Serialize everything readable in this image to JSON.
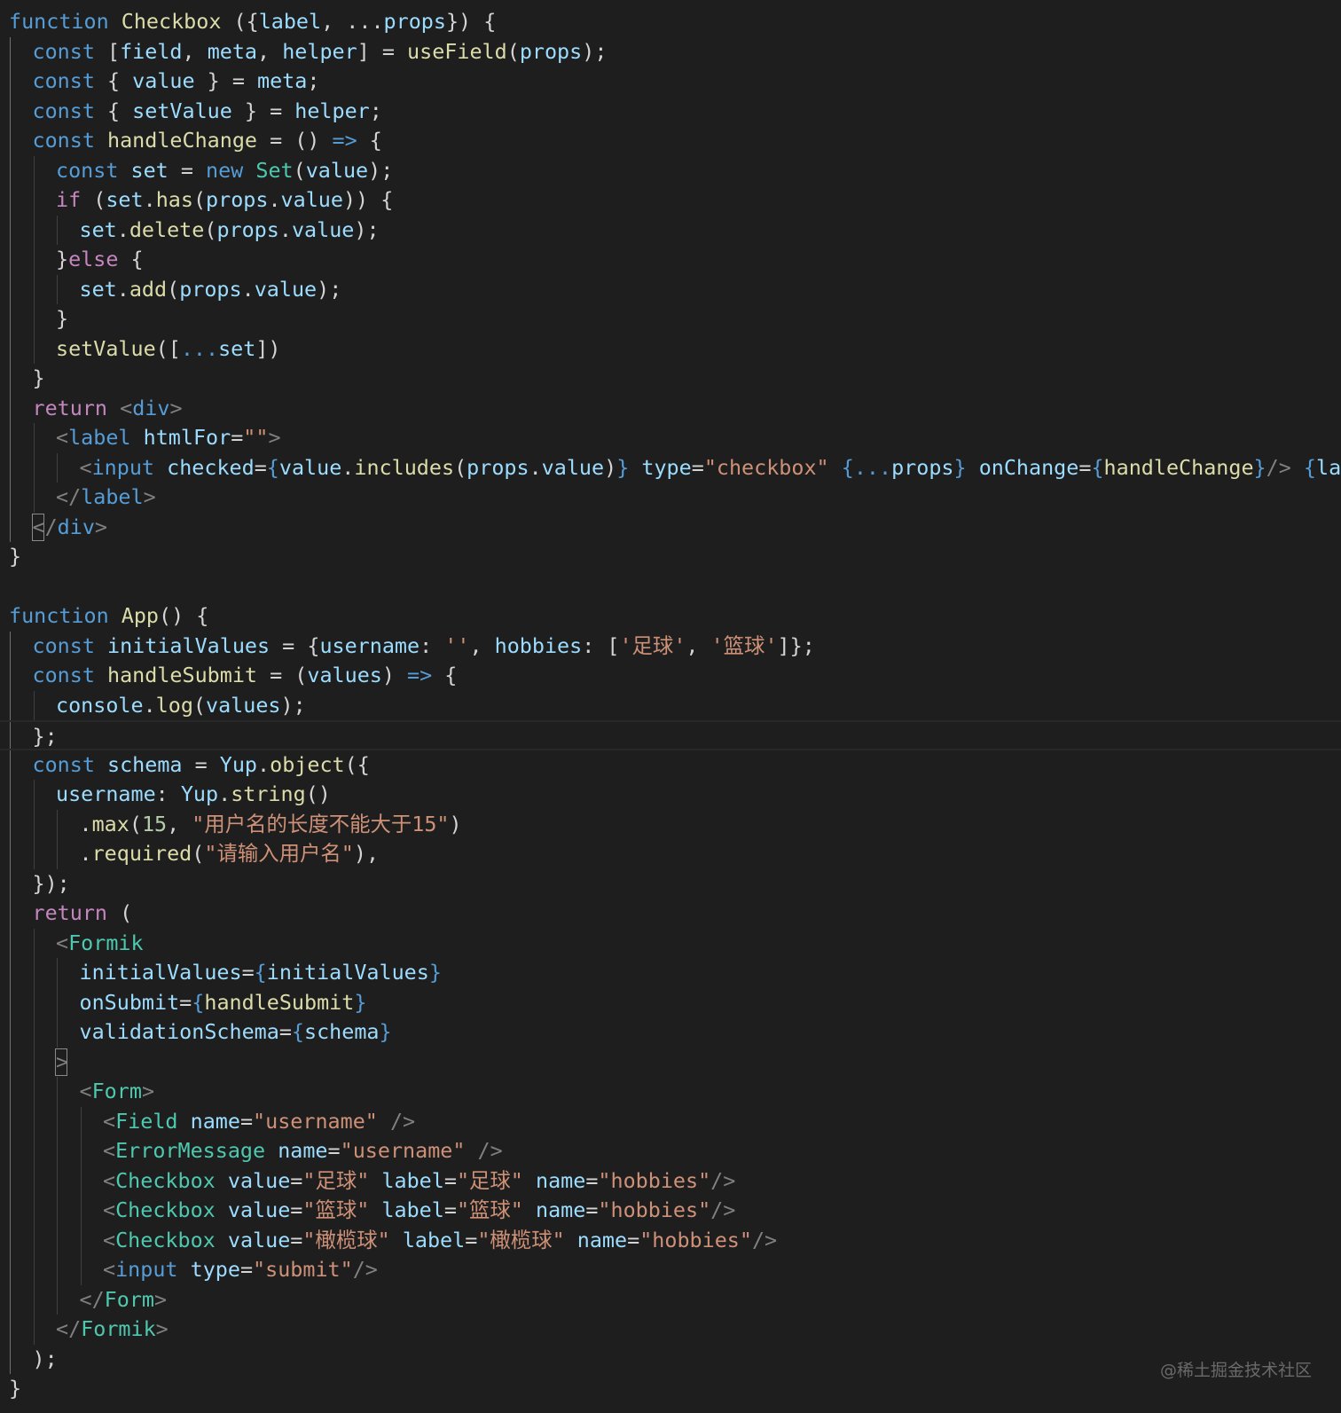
{
  "colors": {
    "background": "#1e1e1e",
    "keyword": "#569cd6",
    "function": "#dcdcaa",
    "variable": "#9cdcfe",
    "type": "#4ec9b0",
    "string": "#ce9178",
    "control": "#c586c0",
    "number": "#b5cea8",
    "tag_punct": "#808080",
    "plain": "#d4d4d4"
  },
  "current_line_index": 24,
  "lines": [
    {
      "i": 0,
      "t": [
        [
          "function",
          "kw"
        ],
        [
          " "
        ],
        [
          "Checkbox",
          "fn"
        ],
        [
          " ({"
        ],
        [
          "label",
          "var"
        ],
        [
          ", ..."
        ],
        [
          "props",
          "var"
        ],
        [
          "}) {"
        ]
      ]
    },
    {
      "i": 1,
      "t": [
        [
          "const",
          "kw"
        ],
        [
          " ["
        ],
        [
          "field",
          "var"
        ],
        [
          ", "
        ],
        [
          "meta",
          "var"
        ],
        [
          ", "
        ],
        [
          "helper",
          "var"
        ],
        [
          "] = "
        ],
        [
          "useField",
          "fn"
        ],
        [
          "("
        ],
        [
          "props",
          "var"
        ],
        [
          ");"
        ]
      ]
    },
    {
      "i": 1,
      "t": [
        [
          "const",
          "kw"
        ],
        [
          " { "
        ],
        [
          "value",
          "var"
        ],
        [
          " } = "
        ],
        [
          "meta",
          "var"
        ],
        [
          ";"
        ]
      ]
    },
    {
      "i": 1,
      "t": [
        [
          "const",
          "kw"
        ],
        [
          " { "
        ],
        [
          "setValue",
          "var"
        ],
        [
          " } = "
        ],
        [
          "helper",
          "var"
        ],
        [
          ";"
        ]
      ]
    },
    {
      "i": 1,
      "t": [
        [
          "const",
          "kw"
        ],
        [
          " "
        ],
        [
          "handleChange",
          "fn"
        ],
        [
          " = () "
        ],
        [
          "=>",
          "kw"
        ],
        [
          " {"
        ]
      ]
    },
    {
      "i": 2,
      "t": [
        [
          "const",
          "kw"
        ],
        [
          " "
        ],
        [
          "set",
          "var"
        ],
        [
          " = "
        ],
        [
          "new",
          "kw"
        ],
        [
          " "
        ],
        [
          "Set",
          "type"
        ],
        [
          "("
        ],
        [
          "value",
          "var"
        ],
        [
          ");"
        ]
      ]
    },
    {
      "i": 2,
      "t": [
        [
          "if",
          "ctl"
        ],
        [
          " ("
        ],
        [
          "set",
          "var"
        ],
        [
          "."
        ],
        [
          "has",
          "fn"
        ],
        [
          "("
        ],
        [
          "props",
          "var"
        ],
        [
          "."
        ],
        [
          "value",
          "var"
        ],
        [
          ")) {"
        ]
      ]
    },
    {
      "i": 3,
      "t": [
        [
          "set",
          "var"
        ],
        [
          "."
        ],
        [
          "delete",
          "fn"
        ],
        [
          "("
        ],
        [
          "props",
          "var"
        ],
        [
          "."
        ],
        [
          "value",
          "var"
        ],
        [
          ");"
        ]
      ]
    },
    {
      "i": 2,
      "t": [
        [
          "}"
        ],
        [
          "else",
          "ctl"
        ],
        [
          " {"
        ]
      ]
    },
    {
      "i": 3,
      "t": [
        [
          "set",
          "var"
        ],
        [
          "."
        ],
        [
          "add",
          "fn"
        ],
        [
          "("
        ],
        [
          "props",
          "var"
        ],
        [
          "."
        ],
        [
          "value",
          "var"
        ],
        [
          ");"
        ]
      ]
    },
    {
      "i": 2,
      "t": [
        [
          "}"
        ]
      ]
    },
    {
      "i": 2,
      "t": [
        [
          "setValue",
          "fn"
        ],
        [
          "(["
        ],
        [
          "...",
          "kw"
        ],
        [
          "set",
          "var"
        ],
        [
          "])"
        ]
      ]
    },
    {
      "i": 1,
      "t": [
        [
          "}"
        ]
      ]
    },
    {
      "i": 1,
      "t": [
        [
          "return",
          "ctl"
        ],
        [
          " "
        ],
        [
          "<",
          "tp"
        ],
        [
          "div",
          "kw"
        ],
        [
          ">",
          "tp"
        ]
      ]
    },
    {
      "i": 2,
      "t": [
        [
          "<",
          "tp"
        ],
        [
          "label",
          "kw"
        ],
        [
          " "
        ],
        [
          "htmlFor",
          "var"
        ],
        [
          "="
        ],
        [
          "\"\"",
          "str"
        ],
        [
          ">",
          "tp"
        ]
      ]
    },
    {
      "i": 3,
      "t": [
        [
          "<",
          "tp"
        ],
        [
          "input",
          "kw"
        ],
        [
          " "
        ],
        [
          "checked",
          "var"
        ],
        [
          "="
        ],
        [
          "{",
          "kw"
        ],
        [
          "value",
          "var"
        ],
        [
          "."
        ],
        [
          "includes",
          "fn"
        ],
        [
          "("
        ],
        [
          "props",
          "var"
        ],
        [
          "."
        ],
        [
          "value",
          "var"
        ],
        [
          ")"
        ],
        [
          "}",
          "kw"
        ],
        [
          " "
        ],
        [
          "type",
          "var"
        ],
        [
          "="
        ],
        [
          "\"checkbox\"",
          "str"
        ],
        [
          " "
        ],
        [
          "{",
          "kw"
        ],
        [
          "...",
          "kw"
        ],
        [
          "props",
          "var"
        ],
        [
          "}",
          "kw"
        ],
        [
          " "
        ],
        [
          "onChange",
          "var"
        ],
        [
          "="
        ],
        [
          "{",
          "kw"
        ],
        [
          "handleChange",
          "fn"
        ],
        [
          "}",
          "kw"
        ],
        [
          "/>",
          "tp"
        ],
        [
          " "
        ],
        [
          "{",
          "kw"
        ],
        [
          "label",
          "var"
        ],
        [
          "}",
          "kw"
        ]
      ]
    },
    {
      "i": 2,
      "t": [
        [
          "</",
          "tp"
        ],
        [
          "label",
          "kw"
        ],
        [
          ">",
          "tp"
        ]
      ]
    },
    {
      "i": 1,
      "t": [
        [
          "</",
          "tp"
        ],
        [
          "div",
          "kw"
        ],
        [
          ">",
          "tp"
        ]
      ]
    },
    {
      "i": 0,
      "t": [
        [
          "}"
        ]
      ]
    },
    {
      "i": 0,
      "t": []
    },
    {
      "i": 0,
      "t": [
        [
          "function",
          "kw"
        ],
        [
          " "
        ],
        [
          "App",
          "fn"
        ],
        [
          "() {"
        ]
      ]
    },
    {
      "i": 1,
      "t": [
        [
          "const",
          "kw"
        ],
        [
          " "
        ],
        [
          "initialValues",
          "var"
        ],
        [
          " = {"
        ],
        [
          "username",
          "var"
        ],
        [
          ": "
        ],
        [
          "''",
          "str"
        ],
        [
          ", "
        ],
        [
          "hobbies",
          "var"
        ],
        [
          ": ["
        ],
        [
          "'足球'",
          "str"
        ],
        [
          ", "
        ],
        [
          "'篮球'",
          "str"
        ],
        [
          "]};"
        ]
      ]
    },
    {
      "i": 1,
      "t": [
        [
          "const",
          "kw"
        ],
        [
          " "
        ],
        [
          "handleSubmit",
          "fn"
        ],
        [
          " = ("
        ],
        [
          "values",
          "var"
        ],
        [
          ") "
        ],
        [
          "=>",
          "kw"
        ],
        [
          " {"
        ]
      ]
    },
    {
      "i": 2,
      "t": [
        [
          "console",
          "var"
        ],
        [
          "."
        ],
        [
          "log",
          "fn"
        ],
        [
          "("
        ],
        [
          "values",
          "var"
        ],
        [
          ");"
        ]
      ]
    },
    {
      "i": 1,
      "t": [
        [
          "};"
        ]
      ]
    },
    {
      "i": 1,
      "t": [
        [
          "const",
          "kw"
        ],
        [
          " "
        ],
        [
          "schema",
          "var"
        ],
        [
          " = "
        ],
        [
          "Yup",
          "var"
        ],
        [
          "."
        ],
        [
          "object",
          "fn"
        ],
        [
          "({"
        ]
      ]
    },
    {
      "i": 2,
      "t": [
        [
          "username",
          "var"
        ],
        [
          ": "
        ],
        [
          "Yup",
          "var"
        ],
        [
          "."
        ],
        [
          "string",
          "fn"
        ],
        [
          "()"
        ]
      ]
    },
    {
      "i": 3,
      "t": [
        [
          "."
        ],
        [
          "max",
          "fn"
        ],
        [
          "("
        ],
        [
          "15",
          "num"
        ],
        [
          ", "
        ],
        [
          "\"用户名的长度不能大于15\"",
          "str"
        ],
        [
          ")"
        ]
      ]
    },
    {
      "i": 3,
      "t": [
        [
          "."
        ],
        [
          "required",
          "fn"
        ],
        [
          "("
        ],
        [
          "\"请输入用户名\"",
          "str"
        ],
        [
          "),"
        ]
      ]
    },
    {
      "i": 1,
      "t": [
        [
          "});"
        ]
      ]
    },
    {
      "i": 1,
      "t": [
        [
          "return",
          "ctl"
        ],
        [
          " ("
        ]
      ]
    },
    {
      "i": 2,
      "t": [
        [
          "<",
          "tp"
        ],
        [
          "Formik",
          "type"
        ]
      ]
    },
    {
      "i": 3,
      "t": [
        [
          "initialValues",
          "var"
        ],
        [
          "="
        ],
        [
          "{",
          "kw"
        ],
        [
          "initialValues",
          "var"
        ],
        [
          "}",
          "kw"
        ]
      ]
    },
    {
      "i": 3,
      "t": [
        [
          "onSubmit",
          "var"
        ],
        [
          "="
        ],
        [
          "{",
          "kw"
        ],
        [
          "handleSubmit",
          "fn"
        ],
        [
          "}",
          "kw"
        ]
      ]
    },
    {
      "i": 3,
      "t": [
        [
          "validationSchema",
          "var"
        ],
        [
          "="
        ],
        [
          "{",
          "kw"
        ],
        [
          "schema",
          "var"
        ],
        [
          "}",
          "kw"
        ]
      ]
    },
    {
      "i": 2,
      "t": [
        [
          ">",
          "tp"
        ]
      ]
    },
    {
      "i": 3,
      "t": [
        [
          "<",
          "tp"
        ],
        [
          "Form",
          "type"
        ],
        [
          ">",
          "tp"
        ]
      ]
    },
    {
      "i": 4,
      "t": [
        [
          "<",
          "tp"
        ],
        [
          "Field",
          "type"
        ],
        [
          " "
        ],
        [
          "name",
          "var"
        ],
        [
          "="
        ],
        [
          "\"username\"",
          "str"
        ],
        [
          " "
        ],
        [
          "/>",
          "tp"
        ]
      ]
    },
    {
      "i": 4,
      "t": [
        [
          "<",
          "tp"
        ],
        [
          "ErrorMessage",
          "type"
        ],
        [
          " "
        ],
        [
          "name",
          "var"
        ],
        [
          "="
        ],
        [
          "\"username\"",
          "str"
        ],
        [
          " "
        ],
        [
          "/>",
          "tp"
        ]
      ]
    },
    {
      "i": 4,
      "t": [
        [
          "<",
          "tp"
        ],
        [
          "Checkbox",
          "type"
        ],
        [
          " "
        ],
        [
          "value",
          "var"
        ],
        [
          "="
        ],
        [
          "\"足球\"",
          "str"
        ],
        [
          " "
        ],
        [
          "label",
          "var"
        ],
        [
          "="
        ],
        [
          "\"足球\"",
          "str"
        ],
        [
          " "
        ],
        [
          "name",
          "var"
        ],
        [
          "="
        ],
        [
          "\"hobbies\"",
          "str"
        ],
        [
          "/>",
          "tp"
        ]
      ]
    },
    {
      "i": 4,
      "t": [
        [
          "<",
          "tp"
        ],
        [
          "Checkbox",
          "type"
        ],
        [
          " "
        ],
        [
          "value",
          "var"
        ],
        [
          "="
        ],
        [
          "\"篮球\"",
          "str"
        ],
        [
          " "
        ],
        [
          "label",
          "var"
        ],
        [
          "="
        ],
        [
          "\"篮球\"",
          "str"
        ],
        [
          " "
        ],
        [
          "name",
          "var"
        ],
        [
          "="
        ],
        [
          "\"hobbies\"",
          "str"
        ],
        [
          "/>",
          "tp"
        ]
      ]
    },
    {
      "i": 4,
      "t": [
        [
          "<",
          "tp"
        ],
        [
          "Checkbox",
          "type"
        ],
        [
          " "
        ],
        [
          "value",
          "var"
        ],
        [
          "="
        ],
        [
          "\"橄榄球\"",
          "str"
        ],
        [
          " "
        ],
        [
          "label",
          "var"
        ],
        [
          "="
        ],
        [
          "\"橄榄球\"",
          "str"
        ],
        [
          " "
        ],
        [
          "name",
          "var"
        ],
        [
          "="
        ],
        [
          "\"hobbies\"",
          "str"
        ],
        [
          "/>",
          "tp"
        ]
      ]
    },
    {
      "i": 4,
      "t": [
        [
          "<",
          "tp"
        ],
        [
          "input",
          "kw"
        ],
        [
          " "
        ],
        [
          "type",
          "var"
        ],
        [
          "="
        ],
        [
          "\"submit\"",
          "str"
        ],
        [
          "/>",
          "tp"
        ]
      ]
    },
    {
      "i": 3,
      "t": [
        [
          "</",
          "tp"
        ],
        [
          "Form",
          "type"
        ],
        [
          ">",
          "tp"
        ]
      ]
    },
    {
      "i": 2,
      "t": [
        [
          "</",
          "tp"
        ],
        [
          "Formik",
          "type"
        ],
        [
          ">",
          "tp"
        ]
      ]
    },
    {
      "i": 1,
      "t": [
        [
          ");"
        ]
      ]
    },
    {
      "i": 0,
      "t": [
        [
          "}"
        ]
      ]
    }
  ],
  "watermark": "@稀土掘金技术社区"
}
